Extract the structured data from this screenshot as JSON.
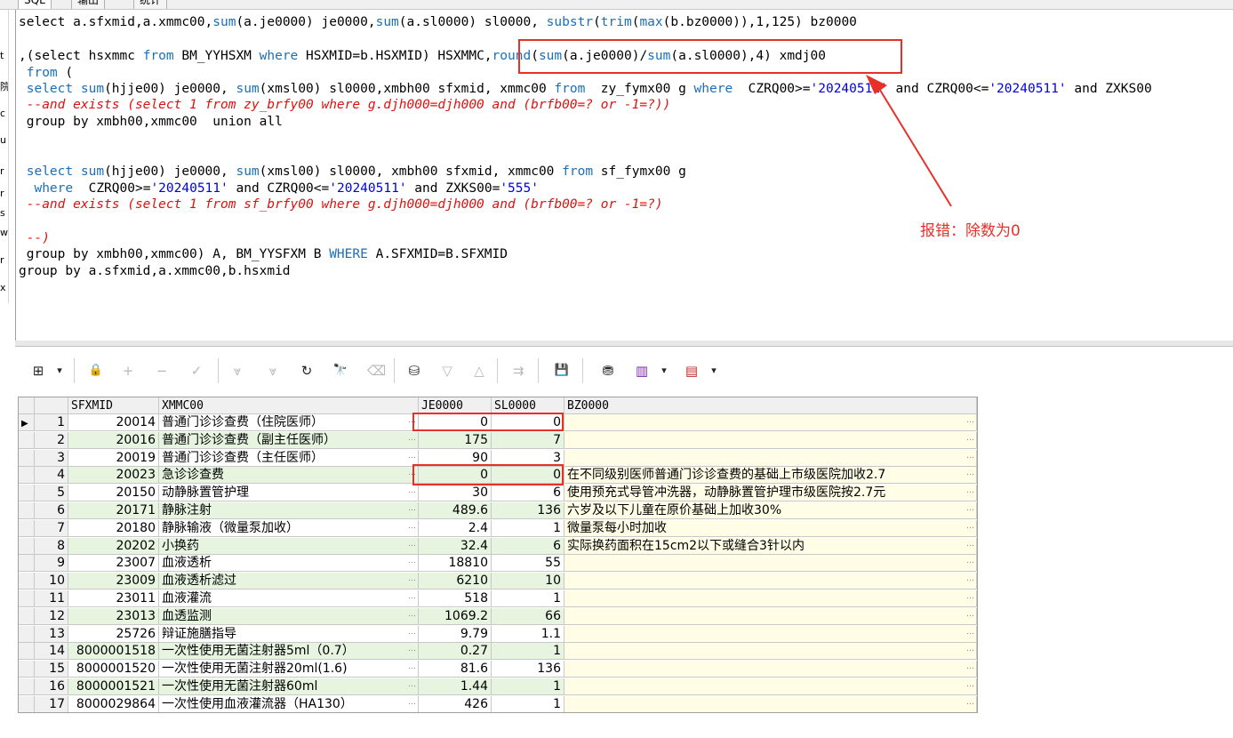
{
  "tabs": [
    "SQL",
    "输出",
    "统计"
  ],
  "gutter_chars": [
    "t",
    "院",
    "c",
    "u",
    "r",
    "r",
    "s",
    "w",
    "r",
    "x"
  ],
  "sql_lines": [
    [
      [
        "select a.sfxmid,a.xmmc00,",
        ""
      ],
      [
        "sum",
        "kw"
      ],
      [
        "(a.je0000) je0000,",
        ""
      ],
      [
        "sum",
        "kw"
      ],
      [
        "(a.sl0000) sl0000, ",
        ""
      ],
      [
        "substr",
        "kw"
      ],
      [
        "(",
        ""
      ],
      [
        "trim",
        "kw"
      ],
      [
        "(",
        ""
      ],
      [
        "max",
        "kw"
      ],
      [
        "(b.bz0000)),1,125) bz0000",
        ""
      ]
    ],
    [],
    [
      [
        ",(select hsxmmc ",
        ""
      ],
      [
        "from",
        "kw"
      ],
      [
        " BM_YYHSXM ",
        ""
      ],
      [
        "where",
        "kw"
      ],
      [
        " HSXMID=b.HSXMID) HSXMMC,",
        ""
      ],
      [
        "round",
        "kw"
      ],
      [
        "(",
        ""
      ],
      [
        "sum",
        "kw"
      ],
      [
        "(a.je0000)/",
        ""
      ],
      [
        "sum",
        "kw"
      ],
      [
        "(a.sl0000),4) xmdj00",
        ""
      ]
    ],
    [
      [
        " ",
        ""
      ],
      [
        "from",
        "kw"
      ],
      [
        " (",
        ""
      ]
    ],
    [
      [
        " ",
        ""
      ],
      [
        "select",
        "kw"
      ],
      [
        " ",
        ""
      ],
      [
        "sum",
        "kw"
      ],
      [
        "(hjje00) je0000, ",
        ""
      ],
      [
        "sum",
        "kw"
      ],
      [
        "(xmsl00) sl0000,xmbh00 sfxmid, xmmc00 ",
        ""
      ],
      [
        "from",
        "kw"
      ],
      [
        "  zy_fymx00 g ",
        ""
      ],
      [
        "where",
        "kw"
      ],
      [
        "  CZRQ00>=",
        ""
      ],
      [
        "'20240511'",
        "str"
      ],
      [
        " and CZRQ00<=",
        ""
      ],
      [
        "'20240511'",
        "str"
      ],
      [
        " and ZXKS00",
        ""
      ]
    ],
    [
      [
        " --and exists (select 1 from zy_brfy00 where g.djh000=djh000 and (brfb00=? or -1=?))",
        "cmt"
      ]
    ],
    [
      [
        " group by xmbh00,xmmc00  union all",
        ""
      ]
    ],
    [],
    [],
    [
      [
        " ",
        ""
      ],
      [
        "select",
        "kw"
      ],
      [
        " ",
        ""
      ],
      [
        "sum",
        "kw"
      ],
      [
        "(hjje00) je0000, ",
        ""
      ],
      [
        "sum",
        "kw"
      ],
      [
        "(xmsl00) sl0000, xmbh00 sfxmid, xmmc00 ",
        ""
      ],
      [
        "from",
        "kw"
      ],
      [
        " sf_fymx00 g",
        ""
      ]
    ],
    [
      [
        "  ",
        ""
      ],
      [
        "where",
        "kw"
      ],
      [
        "  CZRQ00>=",
        ""
      ],
      [
        "'20240511'",
        "str"
      ],
      [
        " and CZRQ00<=",
        ""
      ],
      [
        "'20240511'",
        "str"
      ],
      [
        " and ZXKS00=",
        ""
      ],
      [
        "'555'",
        "str"
      ]
    ],
    [
      [
        " --and exists (select 1 from sf_brfy00 where g.djh000=djh000 and (brfb00=? or -1=?)",
        "cmt"
      ]
    ],
    [],
    [
      [
        " --)",
        "cmt"
      ]
    ],
    [
      [
        " group by xmbh00,xmmc00) A, BM_YYSFXM B ",
        ""
      ],
      [
        "WHERE",
        "kw"
      ],
      [
        " A.SFXMID=B.SFXMID",
        ""
      ]
    ],
    [
      [
        "group by a.sfxmid,a.xmmc00,b.hsxmid",
        ""
      ]
    ]
  ],
  "annotation": {
    "label": "报错：除数为0",
    "color": "#e8302a"
  },
  "toolbar_icons": [
    {
      "name": "grid-layout-icon",
      "glyph": "⊞"
    },
    {
      "name": "dropdown-arrow-icon",
      "glyph": "▾"
    },
    {
      "name": "lock-icon",
      "glyph": "🔒"
    },
    {
      "name": "add-record-icon",
      "glyph": "+"
    },
    {
      "name": "delete-record-icon",
      "glyph": "−"
    },
    {
      "name": "post-check-icon",
      "glyph": "✓"
    },
    {
      "name": "first-record-icon",
      "glyph": "⩔"
    },
    {
      "name": "last-record-icon",
      "glyph": "⩔"
    },
    {
      "name": "refresh-icon",
      "glyph": "↻"
    },
    {
      "name": "find-binoculars-icon",
      "glyph": "🔭"
    },
    {
      "name": "clear-eraser-icon",
      "glyph": "⌫"
    },
    {
      "name": "query-icon",
      "glyph": "⛁"
    },
    {
      "name": "sort-desc-icon",
      "glyph": "▽"
    },
    {
      "name": "sort-asc-icon",
      "glyph": "△"
    },
    {
      "name": "export-icon",
      "glyph": "⇉"
    },
    {
      "name": "save-icon",
      "glyph": "💾"
    },
    {
      "name": "database-icon",
      "glyph": "⛃"
    },
    {
      "name": "chart-icon",
      "glyph": "▥"
    },
    {
      "name": "chart-dropdown-icon",
      "glyph": "▾"
    },
    {
      "name": "report-icon",
      "glyph": "▤"
    },
    {
      "name": "report-dropdown-icon",
      "glyph": "▾"
    }
  ],
  "grid": {
    "columns": [
      "SFXMID",
      "XMMC00",
      "JE0000",
      "SL0000",
      "BZ0000"
    ],
    "rows": [
      {
        "n": "1",
        "sfxmid": "20014",
        "xmmc00": "普通门诊诊查费（住院医师）",
        "je0000": "0",
        "sl0000": "0",
        "bz0000": ""
      },
      {
        "n": "2",
        "sfxmid": "20016",
        "xmmc00": "普通门诊诊查费（副主任医师）",
        "je0000": "175",
        "sl0000": "7",
        "bz0000": ""
      },
      {
        "n": "3",
        "sfxmid": "20019",
        "xmmc00": "普通门诊诊查费（主任医师）",
        "je0000": "90",
        "sl0000": "3",
        "bz0000": ""
      },
      {
        "n": "4",
        "sfxmid": "20023",
        "xmmc00": "急诊诊查费",
        "je0000": "0",
        "sl0000": "0",
        "bz0000": "在不同级别医师普通门诊诊查费的基础上市级医院加收2.7"
      },
      {
        "n": "5",
        "sfxmid": "20150",
        "xmmc00": "动静脉置管护理",
        "je0000": "30",
        "sl0000": "6",
        "bz0000": "使用预充式导管冲洗器，动静脉置管护理市级医院按2.7元"
      },
      {
        "n": "6",
        "sfxmid": "20171",
        "xmmc00": "静脉注射",
        "je0000": "489.6",
        "sl0000": "136",
        "bz0000": "六岁及以下儿童在原价基础上加收30%"
      },
      {
        "n": "7",
        "sfxmid": "20180",
        "xmmc00": "静脉输液（微量泵加收）",
        "je0000": "2.4",
        "sl0000": "1",
        "bz0000": "微量泵每小时加收"
      },
      {
        "n": "8",
        "sfxmid": "20202",
        "xmmc00": "小换药",
        "je0000": "32.4",
        "sl0000": "6",
        "bz0000": "实际换药面积在15cm2以下或缝合3针以内"
      },
      {
        "n": "9",
        "sfxmid": "23007",
        "xmmc00": "血液透析",
        "je0000": "18810",
        "sl0000": "55",
        "bz0000": ""
      },
      {
        "n": "10",
        "sfxmid": "23009",
        "xmmc00": "血液透析滤过",
        "je0000": "6210",
        "sl0000": "10",
        "bz0000": ""
      },
      {
        "n": "11",
        "sfxmid": "23011",
        "xmmc00": "血液灌流",
        "je0000": "518",
        "sl0000": "1",
        "bz0000": ""
      },
      {
        "n": "12",
        "sfxmid": "23013",
        "xmmc00": "血透监测",
        "je0000": "1069.2",
        "sl0000": "66",
        "bz0000": ""
      },
      {
        "n": "13",
        "sfxmid": "25726",
        "xmmc00": "辩证施膳指导",
        "je0000": "9.79",
        "sl0000": "1.1",
        "bz0000": ""
      },
      {
        "n": "14",
        "sfxmid": "8000001518",
        "xmmc00": "一次性使用无菌注射器5ml（0.7）",
        "je0000": "0.27",
        "sl0000": "1",
        "bz0000": ""
      },
      {
        "n": "15",
        "sfxmid": "8000001520",
        "xmmc00": "一次性使用无菌注射器20ml(1.6)",
        "je0000": "81.6",
        "sl0000": "136",
        "bz0000": ""
      },
      {
        "n": "16",
        "sfxmid": "8000001521",
        "xmmc00": "一次性使用无菌注射器60ml",
        "je0000": "1.44",
        "sl0000": "1",
        "bz0000": ""
      },
      {
        "n": "17",
        "sfxmid": "8000029864",
        "xmmc00": "一次性使用血液灌流器（HA130）",
        "je0000": "426",
        "sl0000": "1",
        "bz0000": ""
      }
    ],
    "current_row_marker": "▶",
    "cell_button": "…"
  }
}
